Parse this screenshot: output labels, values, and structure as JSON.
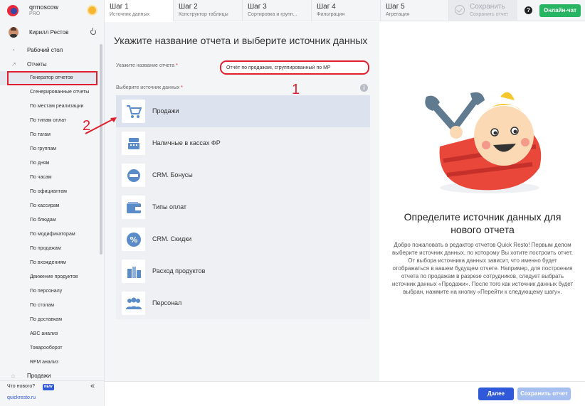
{
  "brand": {
    "name": "qrmoscow",
    "plan": "PRO"
  },
  "user": {
    "name": "Кирилл Рестов"
  },
  "sidebar": {
    "top_items": [
      {
        "label": "Рабочий стол",
        "icon": "dashboard-icon"
      },
      {
        "label": "Отчеты",
        "icon": "reports-icon"
      }
    ],
    "report_items": [
      "Генератор отчетов",
      "Сгенерированные отчеты",
      "По местам реализации",
      "По типам оплат",
      "По тагам",
      "По группам",
      "По дням",
      "По часам",
      "По официантам",
      "По кассирам",
      "По блюдам",
      "По модификаторам",
      "По продажам",
      "По вхождениям",
      "Движение продуктов",
      "По персоналу",
      "По столам",
      "По доставкам",
      "ABC анализ",
      "Товарооборот",
      "RFM анализ"
    ],
    "sales_item": "Продажи",
    "whats_new": "Что нового?",
    "new_badge": "NEW",
    "site": "quickresto.ru"
  },
  "steps": [
    {
      "num": "Шаг 1",
      "sub": "Источник данных"
    },
    {
      "num": "Шаг 2",
      "sub": "Конструктор таблицы"
    },
    {
      "num": "Шаг 3",
      "sub": "Сортировка и групп..."
    },
    {
      "num": "Шаг 4",
      "sub": "Фильтрация"
    },
    {
      "num": "Шаг 5",
      "sub": "Агрегация"
    }
  ],
  "save_step": {
    "num": "Сохранить",
    "sub": "Сохранить отчет"
  },
  "header": {
    "help": "?",
    "chat": "Онлайн-чат"
  },
  "form": {
    "title": "Укажите название отчета и выберите источник данных",
    "name_label": "Укажите название отчета",
    "name_value": "Отчёт по продажам, сгруппированный по МР",
    "source_label": "Выберите источник данных",
    "required": "*",
    "info": "i",
    "sources": [
      "Продажи",
      "Наличные в кассах ФР",
      "CRM. Бонусы",
      "Типы оплат",
      "CRM. Скидки",
      "Расход продуктов",
      "Персонал"
    ]
  },
  "annotations": {
    "one": "1",
    "two": "2"
  },
  "right_panel": {
    "title": "Определите источник данных для нового отчета",
    "description": "Добро пожаловать в редактор отчетов Quick Resto! Первым делом выберите источник данных, по которому Вы хотите построить отчет. От выбора источника данных зависит, что именно будет отображаться в вашем будущем отчете. Например, для построения отчета по продажам в разрезе сотрудников, следует выбрать источник данных «Продажи». После того как источник данных будет выбран, нажмите на кнопку «Перейти к следующему шагу»."
  },
  "footer": {
    "next": "Далее",
    "save": "Сохранить отчет"
  },
  "colors": {
    "accent": "#2f59d9",
    "highlight": "#e0202e",
    "chat": "#27b463"
  }
}
